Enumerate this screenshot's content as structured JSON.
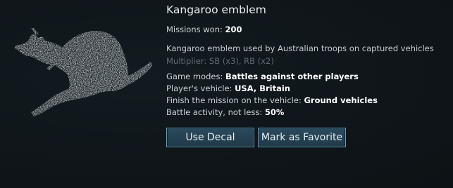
{
  "decal": {
    "title": "Kangaroo emblem",
    "missions_label": "Missions won:",
    "missions_value": "200",
    "description": "Kangaroo emblem used by Australian troops on captured vehicles",
    "multiplier": "Multiplier: SB (x3), RB (x2)",
    "modes_label": "Game modes:",
    "modes_value": "Battles against other players",
    "vehicle_label": "Player's vehicle:",
    "vehicle_value": "USA, Britain",
    "finish_label": "Finish the mission on the vehicle:",
    "finish_value": "Ground vehicles",
    "activity_label": "Battle activity, not less:",
    "activity_value": "50%"
  },
  "buttons": {
    "use_decal": "Use Decal",
    "mark_favorite": "Mark as Favorite"
  },
  "colors": {
    "background": "#0f1519",
    "button_border": "#5e9fbd",
    "button_fill": "#2a4a5c",
    "emblem": "#d7dbdc"
  },
  "icons": {
    "emblem": "kangaroo-emblem-icon"
  }
}
